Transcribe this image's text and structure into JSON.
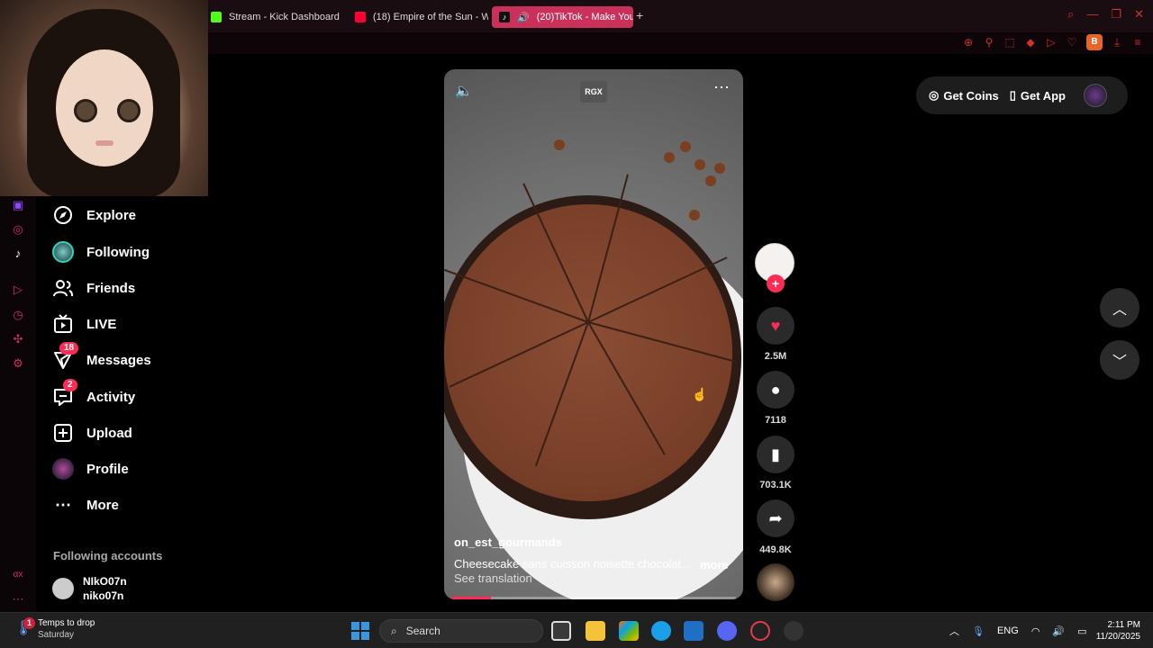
{
  "browser": {
    "tabs": [
      {
        "label": "Stream - Kick Dashboard",
        "color": "#53fc18"
      },
      {
        "label": "(18) Empire of the Sun - W",
        "color": "#ff0033"
      },
      {
        "label": "(20)TikTok - Make You",
        "color": "#ffffff"
      }
    ],
    "new_tab": "+",
    "brave_badge": "B"
  },
  "sidebar": {
    "items": [
      {
        "label": "Explore",
        "icon": "compass-icon"
      },
      {
        "label": "Following",
        "icon": "following-avatar-icon"
      },
      {
        "label": "Friends",
        "icon": "friends-icon"
      },
      {
        "label": "LIVE",
        "icon": "live-icon"
      },
      {
        "label": "Messages",
        "icon": "messages-icon",
        "badge": "18"
      },
      {
        "label": "Activity",
        "icon": "activity-icon",
        "badge": "2"
      },
      {
        "label": "Upload",
        "icon": "upload-icon"
      },
      {
        "label": "Profile",
        "icon": "profile-icon"
      },
      {
        "label": "More",
        "icon": "more-icon"
      }
    ],
    "following_header": "Following accounts",
    "accounts": [
      {
        "name": "NIkO07n",
        "handle": "niko07n"
      }
    ],
    "strip_label": "αx"
  },
  "video": {
    "badge": "RGX",
    "author": "on_est_gourmands",
    "caption": "Cheesecake sans cuisson noisette chocolat...",
    "caption_more": "more",
    "translate": "See translation",
    "progress": 0.14
  },
  "actions": {
    "likes": "2.5M",
    "comments": "7118",
    "saves": "703.1K",
    "shares": "449.8K"
  },
  "header": {
    "get_coins": "Get Coins",
    "get_app": "Get App"
  },
  "taskbar": {
    "weather_title": "Temps to drop",
    "weather_sub": "Saturday",
    "weather_badge": "1",
    "search": "Search",
    "lang": "ENG",
    "time": "2:11 PM",
    "date": "11/20/2025"
  },
  "colors": {
    "accent": "#fe2c55",
    "active_tab": "#c9305a",
    "browser_icons": "#cc3333"
  }
}
